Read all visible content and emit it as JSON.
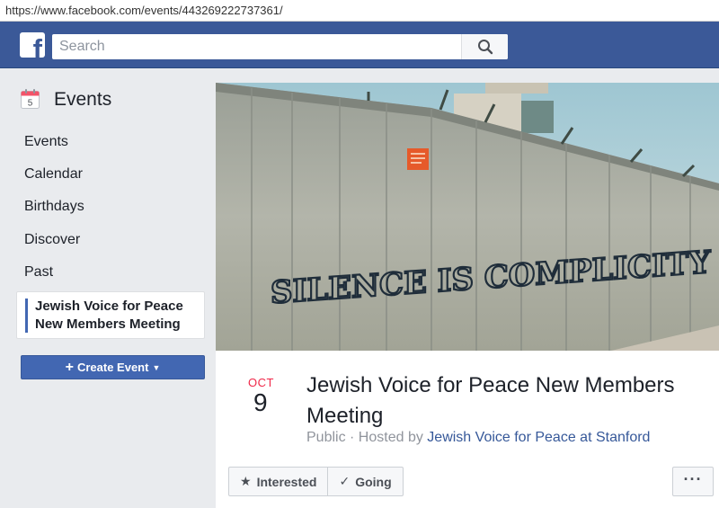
{
  "browser": {
    "url": "https://www.facebook.com/events/443269222737361/"
  },
  "header": {
    "logo_letter": "f",
    "search_placeholder": "Search"
  },
  "sidebar": {
    "calendar_icon_day": "5",
    "title": "Events",
    "items": [
      {
        "label": "Events"
      },
      {
        "label": "Calendar"
      },
      {
        "label": "Birthdays"
      },
      {
        "label": "Discover"
      },
      {
        "label": "Past"
      }
    ],
    "selected_line1": "Jewish Voice for Peace",
    "selected_line2": "New Members Meeting",
    "create_button": "Create Event"
  },
  "event": {
    "cover_text": "SILENCE IS COMPLICITY",
    "month": "OCT",
    "day": "9",
    "title": "Jewish Voice for Peace New Members Meeting",
    "privacy": "Public",
    "hosted_by_label": "· Hosted by",
    "host": "Jewish Voice for Peace at Stanford",
    "actions": {
      "interested": "Interested",
      "going": "Going",
      "more": "···"
    }
  },
  "colors": {
    "header": "#3b5998",
    "accent": "#4267b2",
    "date_month": "#f02849"
  }
}
